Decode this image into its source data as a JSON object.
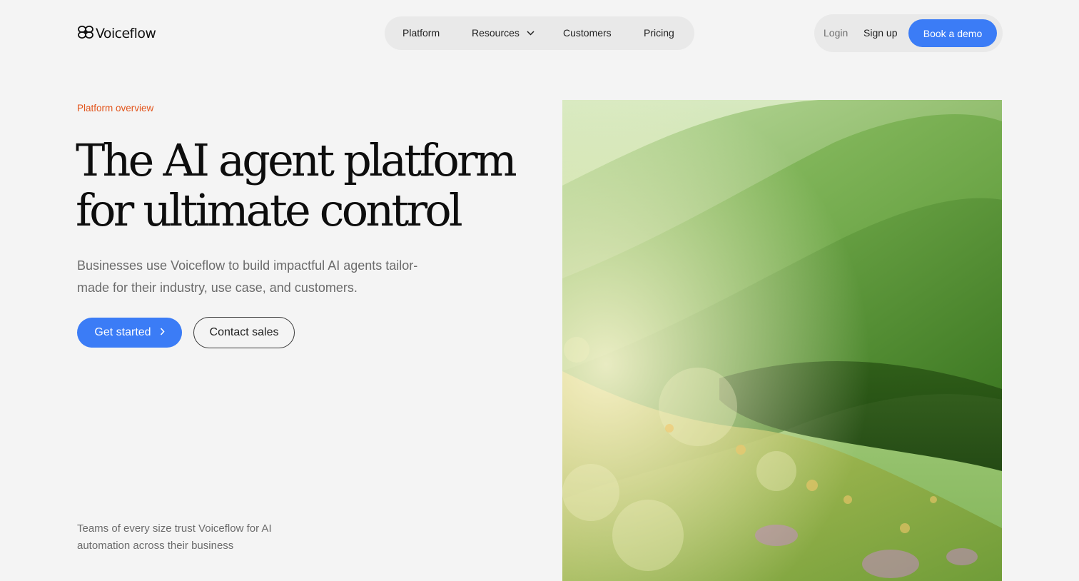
{
  "brand": {
    "name": "Voiceflow",
    "icon": "voiceflow-logo-icon"
  },
  "nav": {
    "items": [
      {
        "label": "Platform"
      },
      {
        "label": "Resources",
        "icon": "chevron-down-icon"
      },
      {
        "label": "Customers"
      },
      {
        "label": "Pricing"
      }
    ]
  },
  "auth": {
    "login": "Login",
    "signup": "Sign up",
    "demo": "Book a demo"
  },
  "hero": {
    "eyebrow": "Platform overview",
    "headline_line1": "The AI agent platform",
    "headline_line2": "for ultimate control",
    "subhead": "Businesses use Voiceflow to build impactful AI agents tailor-made for their industry, use case, and customers.",
    "cta_primary": "Get started",
    "cta_primary_icon": "chevron-right-icon",
    "cta_secondary": "Contact sales"
  },
  "trust": {
    "text": "Teams of every size trust Voiceflow for AI automation across their business"
  },
  "colors": {
    "background": "#f4f4f4",
    "accent": "#3b7cf6",
    "eyebrow": "#e2541b",
    "pill": "#e9e9e9"
  }
}
